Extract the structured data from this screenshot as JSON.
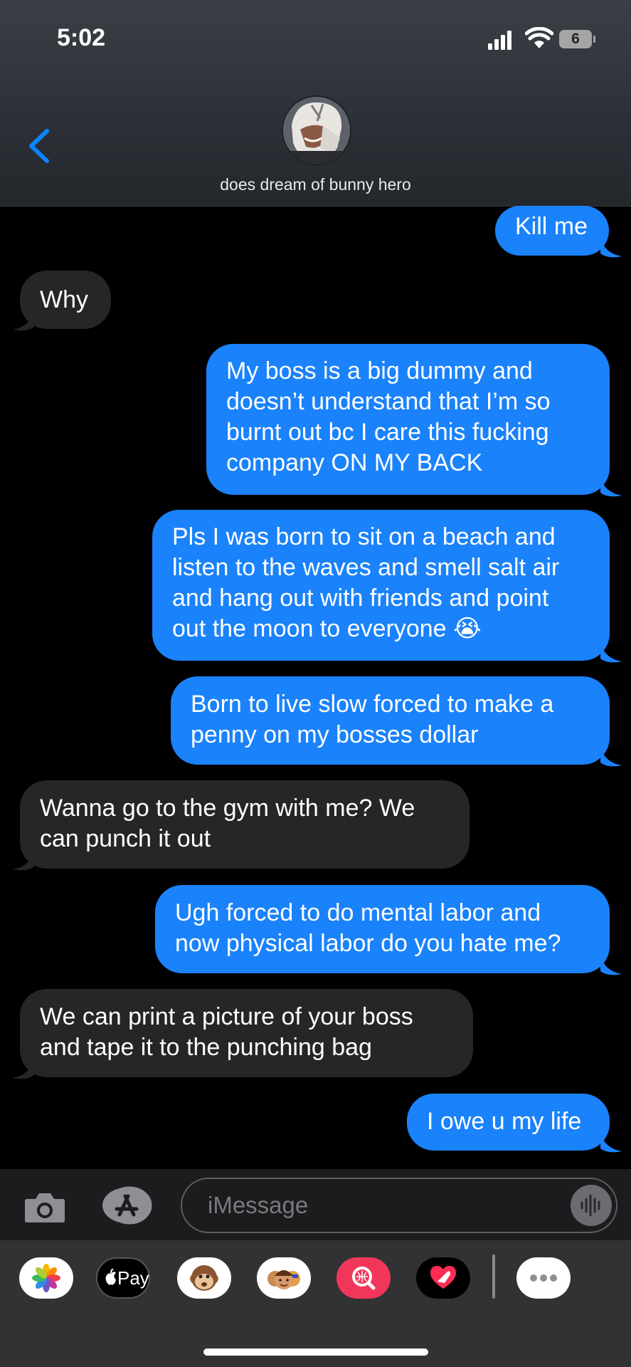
{
  "status": {
    "time": "5:02",
    "battery": "6"
  },
  "contact": {
    "name": "does dream of bunny hero"
  },
  "messages": [
    {
      "from": "me",
      "text": [
        "Kill me"
      ]
    },
    {
      "from": "them",
      "text": [
        "Why"
      ]
    },
    {
      "from": "me",
      "text": [
        "My boss is a big dummy and",
        "doesn’t understand that I’m so",
        "burnt out bc I care this fucking",
        "company ON MY BACK"
      ]
    },
    {
      "from": "me",
      "text": [
        "Pls I was born to sit on a beach and",
        "listen to the waves and smell salt air",
        "and hang out with friends and point",
        "out the moon to everyone 😭"
      ]
    },
    {
      "from": "me",
      "text": [
        "Born to live slow forced to make a",
        "penny on my bosses dollar"
      ]
    },
    {
      "from": "them",
      "text": [
        "Wanna go to the gym with me? We",
        "can punch it out"
      ]
    },
    {
      "from": "me",
      "text": [
        "Ugh forced to do mental labor and",
        "now physical labor do you hate me?"
      ]
    },
    {
      "from": "them",
      "text": [
        "We can print a picture of your boss",
        "and tape it to the punching bag"
      ]
    },
    {
      "from": "me",
      "text": [
        "I owe u my life"
      ]
    }
  ],
  "input": {
    "placeholder": "iMessage"
  },
  "apps": [
    {
      "name": "photos-app-icon"
    },
    {
      "name": "apple-pay-app-icon",
      "label": "Pay"
    },
    {
      "name": "animoji-monkey-icon"
    },
    {
      "name": "memoji-stickers-icon"
    },
    {
      "name": "image-search-icon"
    },
    {
      "name": "digital-touch-icon"
    },
    {
      "name": "more-apps-icon"
    }
  ],
  "colors": {
    "sent": "#1a82fb",
    "received": "#262628",
    "accent": "#0a84ff"
  }
}
